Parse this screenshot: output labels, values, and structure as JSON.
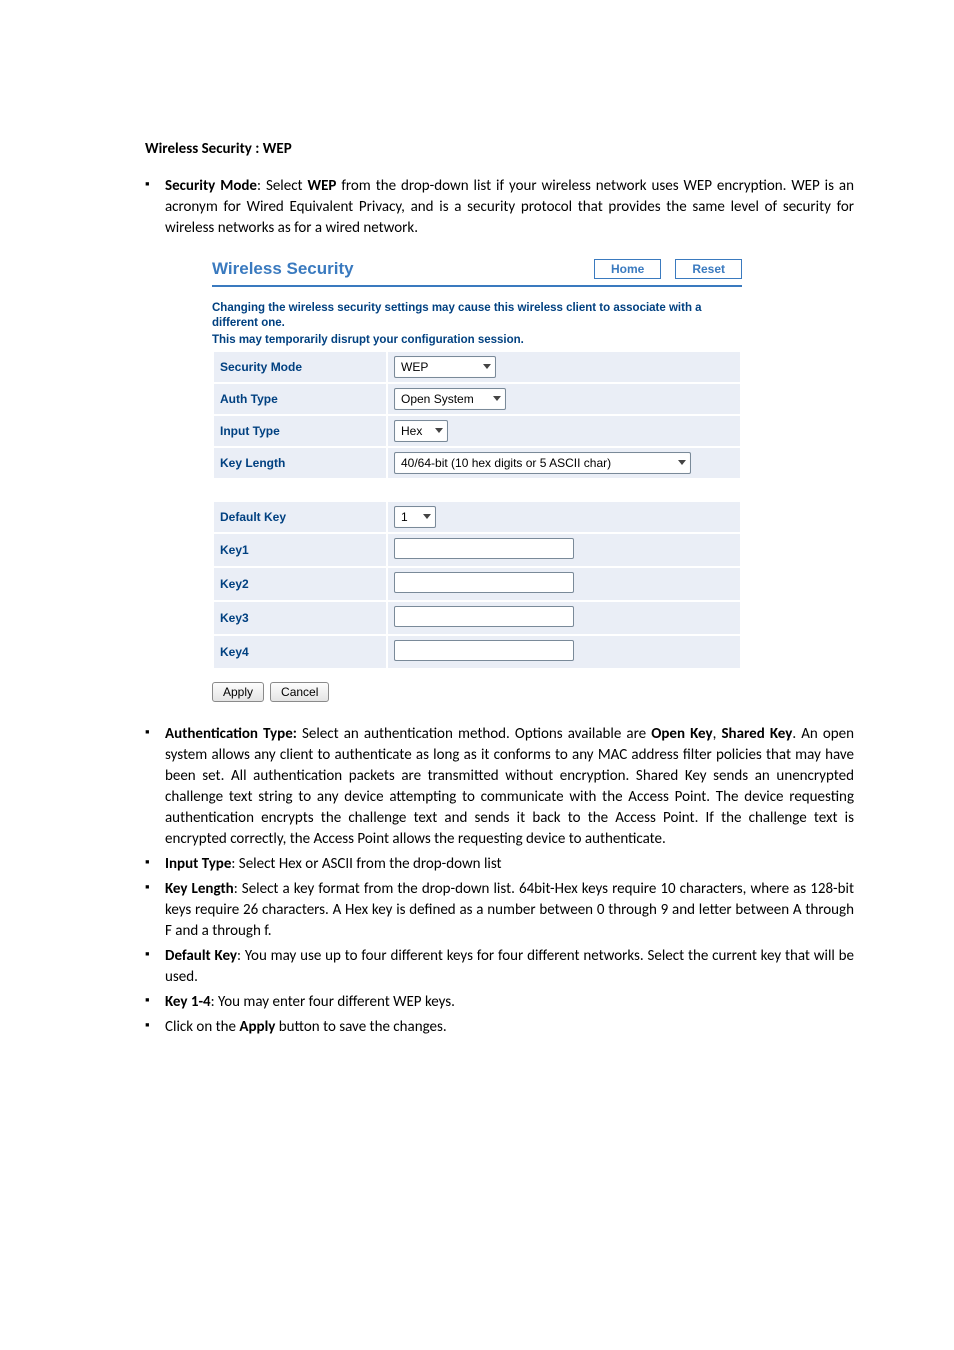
{
  "doc": {
    "section_title": "Wireless Security : WEP",
    "intro_bullet": {
      "prefix": "Security Mode",
      "mid": ": Select ",
      "mode": "WEP",
      "rest": " from the drop-down list if your wireless network uses WEP encryption. WEP is an acronym for Wired Equivalent Privacy, and is a security protocol that provides the same level of security for wireless networks as for a wired network."
    },
    "bullets_after": [
      {
        "b1": "Authentication Type:",
        "t1": " Select an authentication method. Options available are ",
        "b2": "Open Key",
        "t2": ", ",
        "b3": "Shared Key",
        "t3": ". An open system allows any client to authenticate as long as it conforms to any MAC address filter policies that may have been set. All authentication packets are transmitted without encryption. Shared Key sends an unencrypted challenge text string to any device attempting to communicate with the Access Point. The device requesting authentication encrypts the challenge text and sends it back to the Access Point. If the challenge text is encrypted correctly, the Access Point allows the requesting device to authenticate."
      },
      {
        "b1": "Input Type",
        "t1": ": Select Hex or ASCII from the drop-down list"
      },
      {
        "b1": "Key Length",
        "t1": ": Select a key format from the drop-down list. 64bit-Hex keys require 10 characters, where as 128-bit keys require 26 characters. A Hex key is defined as a number between 0 through 9 and letter between A through F and a through f."
      },
      {
        "b1": "Default Key",
        "t1": ": You may use up to four different keys for four different networks. Select the current key that will be used."
      },
      {
        "b1": "Key 1-4",
        "t1": ": You may enter four different WEP keys."
      },
      {
        "t0": "Click on the ",
        "b1": "Apply",
        "t1": " button to save the changes."
      }
    ]
  },
  "ui": {
    "title": "Wireless Security",
    "home_btn": "Home",
    "reset_btn": "Reset",
    "note_line1": "Changing the wireless security settings may cause this wireless client to associate with a different one.",
    "note_line2": "This may temporarily disrupt your configuration session.",
    "rows": {
      "security_mode": {
        "label": "Security Mode",
        "value": "WEP"
      },
      "auth_type": {
        "label": "Auth Type",
        "value": "Open System"
      },
      "input_type": {
        "label": "Input Type",
        "value": "Hex"
      },
      "key_length": {
        "label": "Key Length",
        "value": "40/64-bit (10 hex digits or 5 ASCII char)"
      },
      "default_key": {
        "label": "Default Key",
        "value": "1"
      },
      "key1": {
        "label": "Key1"
      },
      "key2": {
        "label": "Key2"
      },
      "key3": {
        "label": "Key3"
      },
      "key4": {
        "label": "Key4"
      }
    },
    "apply": "Apply",
    "cancel": "Cancel"
  }
}
